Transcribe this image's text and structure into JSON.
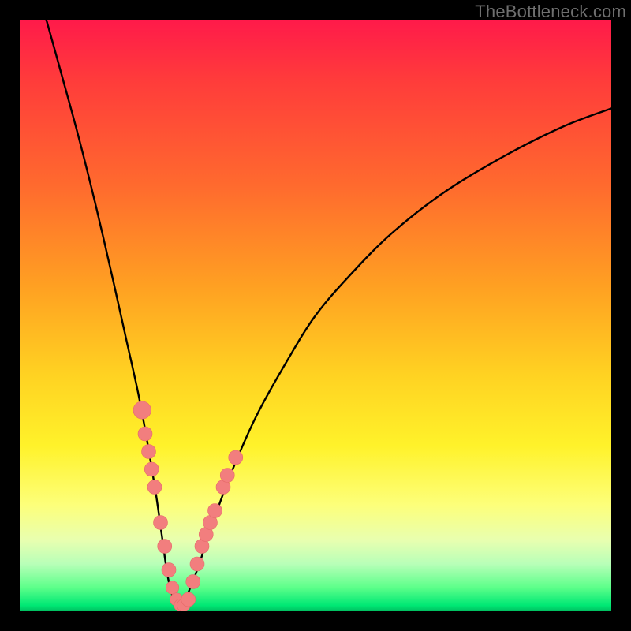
{
  "watermark": "TheBottleneck.com",
  "colors": {
    "curve": "#000000",
    "marker_fill": "#f27e7e",
    "marker_stroke": "#e66a6a"
  },
  "chart_data": {
    "type": "line",
    "title": "",
    "xlabel": "",
    "ylabel": "",
    "xlim": [
      0,
      100
    ],
    "ylim": [
      0,
      100
    ],
    "grid": false,
    "legend": false,
    "series": [
      {
        "name": "bottleneck-curve",
        "x": [
          4.5,
          7,
          10,
          13,
          16,
          18,
          20,
          21.5,
          23,
          24,
          25,
          26,
          27,
          28,
          30,
          33,
          36,
          40,
          45,
          50,
          56,
          63,
          72,
          82,
          92,
          100
        ],
        "y": [
          100,
          91,
          80,
          68,
          55,
          46,
          37,
          29,
          20,
          13,
          6,
          2,
          0,
          2,
          7,
          16,
          24,
          33,
          42,
          50,
          57,
          64,
          71,
          77,
          82,
          85
        ]
      }
    ],
    "markers": [
      {
        "x": 20.7,
        "y": 34,
        "r": 1.5
      },
      {
        "x": 21.2,
        "y": 30,
        "r": 1.2
      },
      {
        "x": 21.8,
        "y": 27,
        "r": 1.2
      },
      {
        "x": 22.3,
        "y": 24,
        "r": 1.2
      },
      {
        "x": 22.8,
        "y": 21,
        "r": 1.2
      },
      {
        "x": 23.8,
        "y": 15,
        "r": 1.2
      },
      {
        "x": 24.5,
        "y": 11,
        "r": 1.2
      },
      {
        "x": 25.2,
        "y": 7,
        "r": 1.2
      },
      {
        "x": 25.8,
        "y": 4,
        "r": 1.1
      },
      {
        "x": 26.5,
        "y": 2,
        "r": 1.1
      },
      {
        "x": 27.2,
        "y": 1,
        "r": 1.1
      },
      {
        "x": 27.7,
        "y": 1,
        "r": 1.1
      },
      {
        "x": 28.5,
        "y": 2,
        "r": 1.2
      },
      {
        "x": 29.3,
        "y": 5,
        "r": 1.2
      },
      {
        "x": 30.0,
        "y": 8,
        "r": 1.2
      },
      {
        "x": 30.8,
        "y": 11,
        "r": 1.2
      },
      {
        "x": 31.5,
        "y": 13,
        "r": 1.2
      },
      {
        "x": 32.2,
        "y": 15,
        "r": 1.2
      },
      {
        "x": 33.0,
        "y": 17,
        "r": 1.2
      },
      {
        "x": 34.4,
        "y": 21,
        "r": 1.2
      },
      {
        "x": 35.1,
        "y": 23,
        "r": 1.2
      },
      {
        "x": 36.5,
        "y": 26,
        "r": 1.2
      }
    ]
  }
}
